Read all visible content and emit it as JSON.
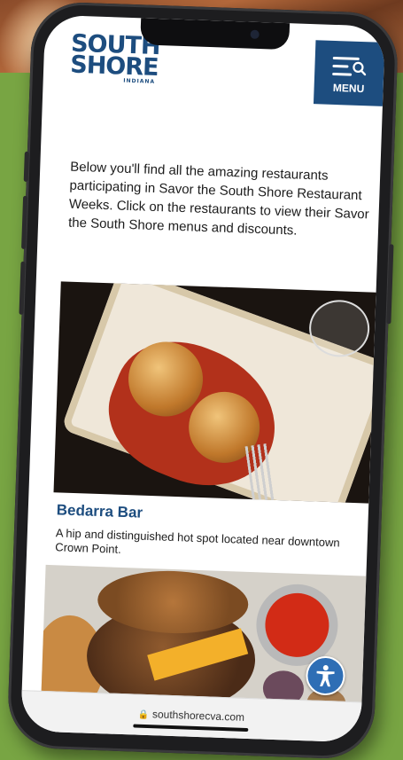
{
  "logo": {
    "line1": "SOUTH",
    "line2": "SHORE",
    "sub": "INDIANA"
  },
  "menu": {
    "label": "MENU"
  },
  "intro": {
    "text": "Below you'll find all the amazing restaurants participating in Savor the South Shore Restaurant Weeks. Click on the restaurants to view their Savor the South Shore menus and discounts."
  },
  "restaurants": [
    {
      "name": "Bedarra Bar",
      "description": "A hip and distinguished hot spot located near downtown Crown Point."
    }
  ],
  "browser": {
    "url": "southshorecva.com"
  },
  "colors": {
    "brand_blue": "#1d4d7f",
    "background_green": "#78a543",
    "accessibility_blue": "#2e6eb5"
  },
  "icons": {
    "menu": "hamburger-search-icon",
    "accessibility": "accessibility-person-icon",
    "lock": "lock-icon"
  }
}
